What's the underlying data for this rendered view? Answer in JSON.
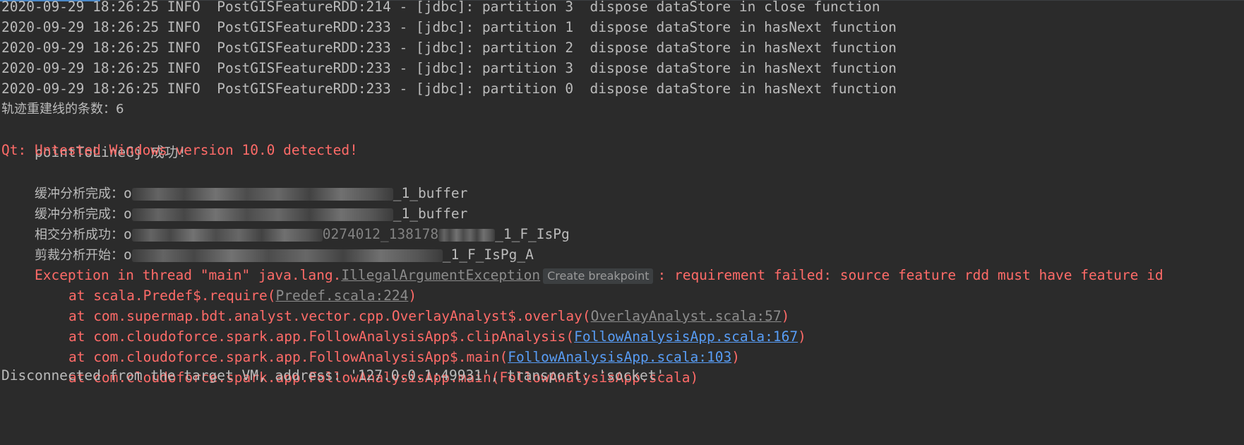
{
  "colors": {
    "background": "#2b2b2b",
    "text_default": "#bbbbbb",
    "text_error": "#ff6b68",
    "link_blue": "#589df6",
    "link_gray": "#8c8c8c"
  },
  "log_lines": [
    "2020-09-29 18:26:25 INFO  PostGISFeatureRDD:214 - [jdbc]: partition 3  dispose dataStore in close function",
    "2020-09-29 18:26:25 INFO  PostGISFeatureRDD:233 - [jdbc]: partition 1  dispose dataStore in hasNext function",
    "2020-09-29 18:26:25 INFO  PostGISFeatureRDD:233 - [jdbc]: partition 2  dispose dataStore in hasNext function",
    "2020-09-29 18:26:25 INFO  PostGISFeatureRDD:233 - [jdbc]: partition 3  dispose dataStore in hasNext function",
    "2020-09-29 18:26:25 INFO  PostGISFeatureRDD:233 - [jdbc]: partition 0  dispose dataStore in hasNext function"
  ],
  "track_line": "轨迹重建线的条数：6",
  "success_line": "pointToLineGj 成功!",
  "qt_warning": "Qt: Untested Windows version 10.0 detected!",
  "analysis_lines": [
    {
      "label": "缓冲分析完成：",
      "prefix": "o",
      "suffix": "_1_buffer"
    },
    {
      "label": "缓冲分析完成：",
      "prefix": "o",
      "suffix": "_1_buffer"
    },
    {
      "label": "相交分析成功：",
      "prefix": "o",
      "suffix": "0274012_138178",
      "suffix2": "_1_F_IsPg"
    },
    {
      "label": "剪裁分析开始：",
      "prefix": "o",
      "suffix": "_1_F_IsPg_A"
    }
  ],
  "exception": {
    "prefix": "Exception in thread \"main\" java.lang.",
    "class_link": "IllegalArgumentException",
    "breakpoint_label": "Create breakpoint",
    "message": ": requirement failed: source feature rdd must have feature id"
  },
  "stack": [
    {
      "pre": "at scala.Predef$.require(",
      "link": "Predef.scala:224",
      "post": ")"
    },
    {
      "pre": "at com.supermap.bdt.analyst.vector.cpp.OverlayAnalyst$.overlay(",
      "link": "OverlayAnalyst.scala:57",
      "post": ")"
    },
    {
      "pre": "at com.cloudoforce.spark.app.FollowAnalysisApp$.clipAnalysis(",
      "link": "FollowAnalysisApp.scala:167",
      "post": ")"
    },
    {
      "pre": "at com.cloudoforce.spark.app.FollowAnalysisApp$.main(",
      "link": "FollowAnalysisApp.scala:103",
      "post": ")"
    },
    {
      "text": "at com.cloudoforce.spark.app.FollowAnalysisApp.main(FollowAnalysisApp.scala)"
    }
  ],
  "disconnected": "Disconnected from the target VM, address: '127.0.0.1:49931', transport: 'socket'"
}
